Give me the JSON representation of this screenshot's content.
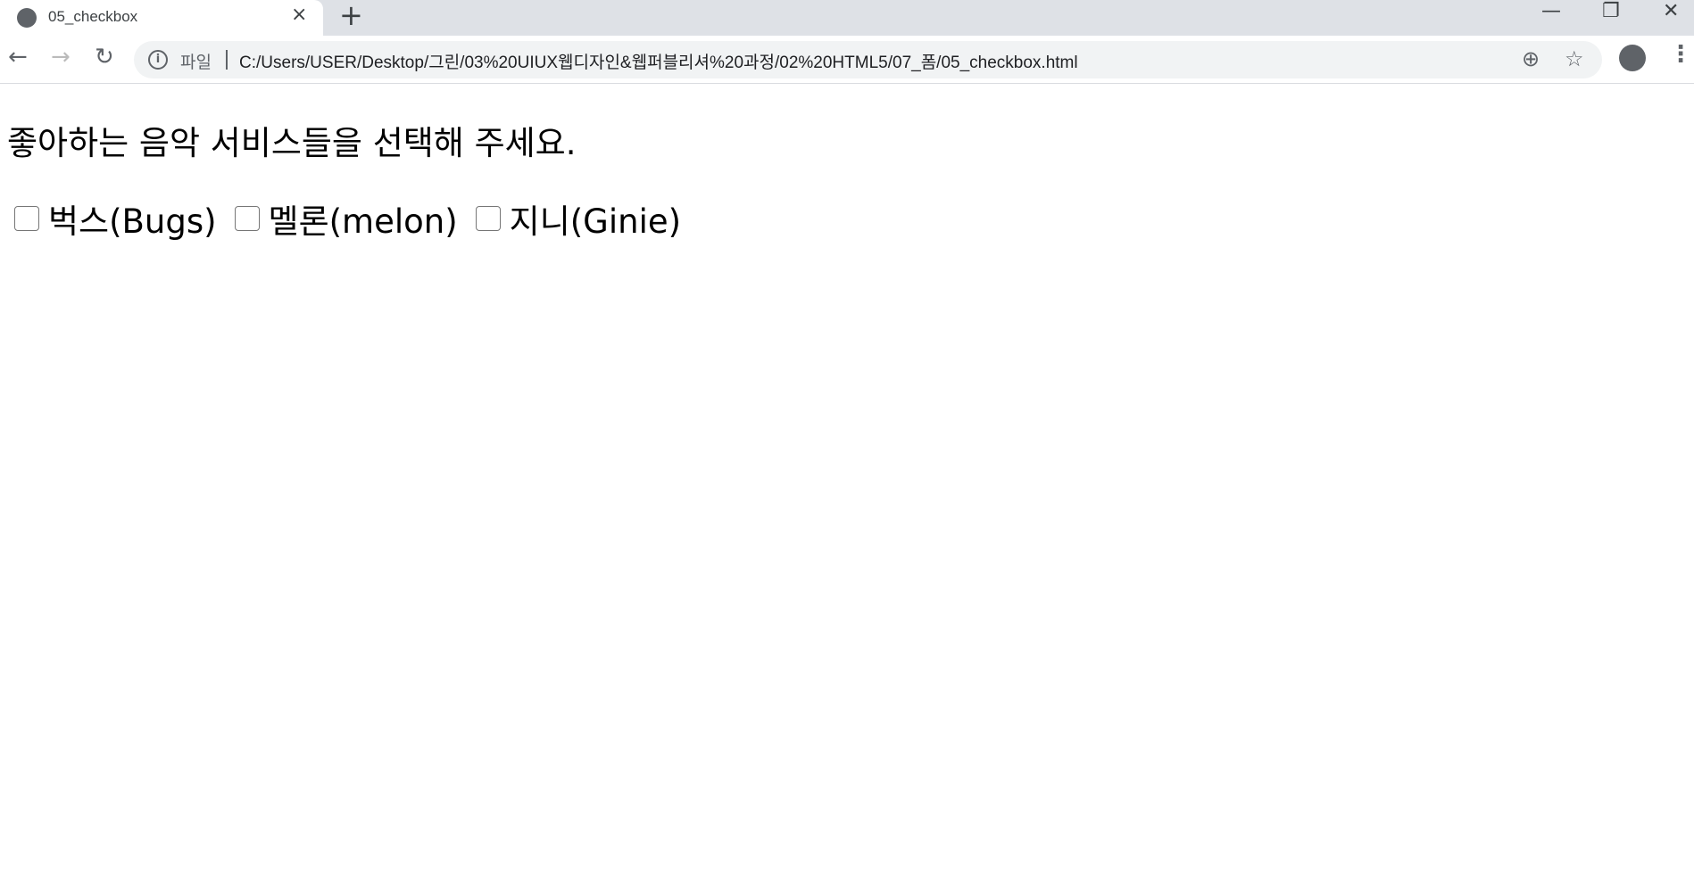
{
  "tab": {
    "title": "05_checkbox",
    "close": "×",
    "new_tab": "+"
  },
  "window": {
    "minimize": "—",
    "restore": "❐",
    "close": "✕"
  },
  "toolbar": {
    "back": "←",
    "forward": "→",
    "reload": "↻",
    "info": "i",
    "scheme_label": "파일",
    "url": "C:/Users/USER/Desktop/그린/03%20UIUX웹디자인&웹퍼블리셔%20과정/02%20HTML5/07_폼/05_checkbox.html",
    "zoom": "⊕",
    "star": "☆",
    "menu": "⋮"
  },
  "page": {
    "heading": "좋아하는 음악 서비스들을 선택해 주세요.",
    "options": [
      {
        "label": "벅스(Bugs)",
        "checked": false
      },
      {
        "label": "멜론(melon)",
        "checked": false
      },
      {
        "label": "지니(Ginie)",
        "checked": false
      }
    ]
  }
}
